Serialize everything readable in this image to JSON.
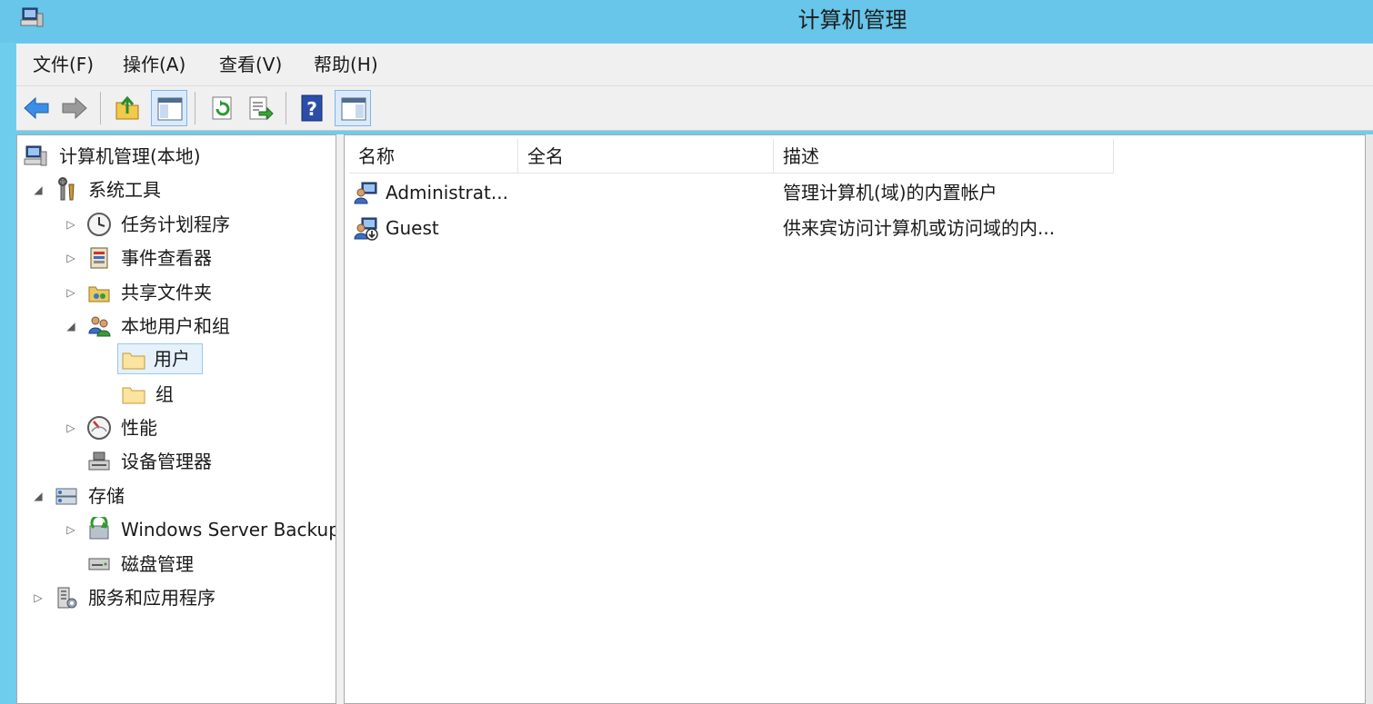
{
  "window": {
    "title": "计算机管理"
  },
  "menu": [
    {
      "label": "文件(F)"
    },
    {
      "label": "操作(A)"
    },
    {
      "label": "查看(V)"
    },
    {
      "label": "帮助(H)"
    }
  ],
  "toolbar": {
    "buttons": [
      {
        "icon": "back-arrow-icon"
      },
      {
        "icon": "forward-arrow-icon"
      },
      {
        "icon": "up-one-level-icon"
      },
      {
        "icon": "show-hide-console-tree-icon"
      },
      {
        "icon": "refresh-icon"
      },
      {
        "icon": "export-list-icon"
      },
      {
        "icon": "help-icon"
      },
      {
        "icon": "show-hide-action-pane-icon"
      }
    ]
  },
  "tree": {
    "items": [
      {
        "label": "计算机管理(本地)",
        "icon": "computer-management-icon",
        "expander": ""
      },
      {
        "label": "系统工具",
        "icon": "system-tools-icon",
        "expander": "◢"
      },
      {
        "label": "任务计划程序",
        "icon": "clock-icon",
        "expander": "▷"
      },
      {
        "label": "事件查看器",
        "icon": "event-viewer-icon",
        "expander": "▷"
      },
      {
        "label": "共享文件夹",
        "icon": "shared-folders-icon",
        "expander": "▷"
      },
      {
        "label": "本地用户和组",
        "icon": "users-groups-icon",
        "expander": "◢"
      },
      {
        "label": "用户",
        "icon": "folder-icon",
        "expander": ""
      },
      {
        "label": "组",
        "icon": "folder-icon",
        "expander": ""
      },
      {
        "label": "性能",
        "icon": "performance-gauge-icon",
        "expander": "▷"
      },
      {
        "label": "设备管理器",
        "icon": "device-manager-icon",
        "expander": ""
      },
      {
        "label": "存储",
        "icon": "storage-icon",
        "expander": "◢"
      },
      {
        "label": "Windows Server Backup",
        "icon": "backup-icon",
        "expander": "▷"
      },
      {
        "label": "磁盘管理",
        "icon": "disk-management-icon",
        "expander": ""
      },
      {
        "label": "服务和应用程序",
        "icon": "services-apps-icon",
        "expander": "▷"
      }
    ]
  },
  "list": {
    "columns": [
      {
        "label": "名称"
      },
      {
        "label": "全名"
      },
      {
        "label": "描述"
      }
    ],
    "rows": [
      {
        "name": "Administrat...",
        "fullname": "",
        "description": "管理计算机(域)的内置帐户",
        "icon": "user-account-icon"
      },
      {
        "name": "Guest",
        "fullname": "",
        "description": "供来宾访问计算机或访问域的内...",
        "icon": "disabled-user-icon"
      }
    ]
  }
}
